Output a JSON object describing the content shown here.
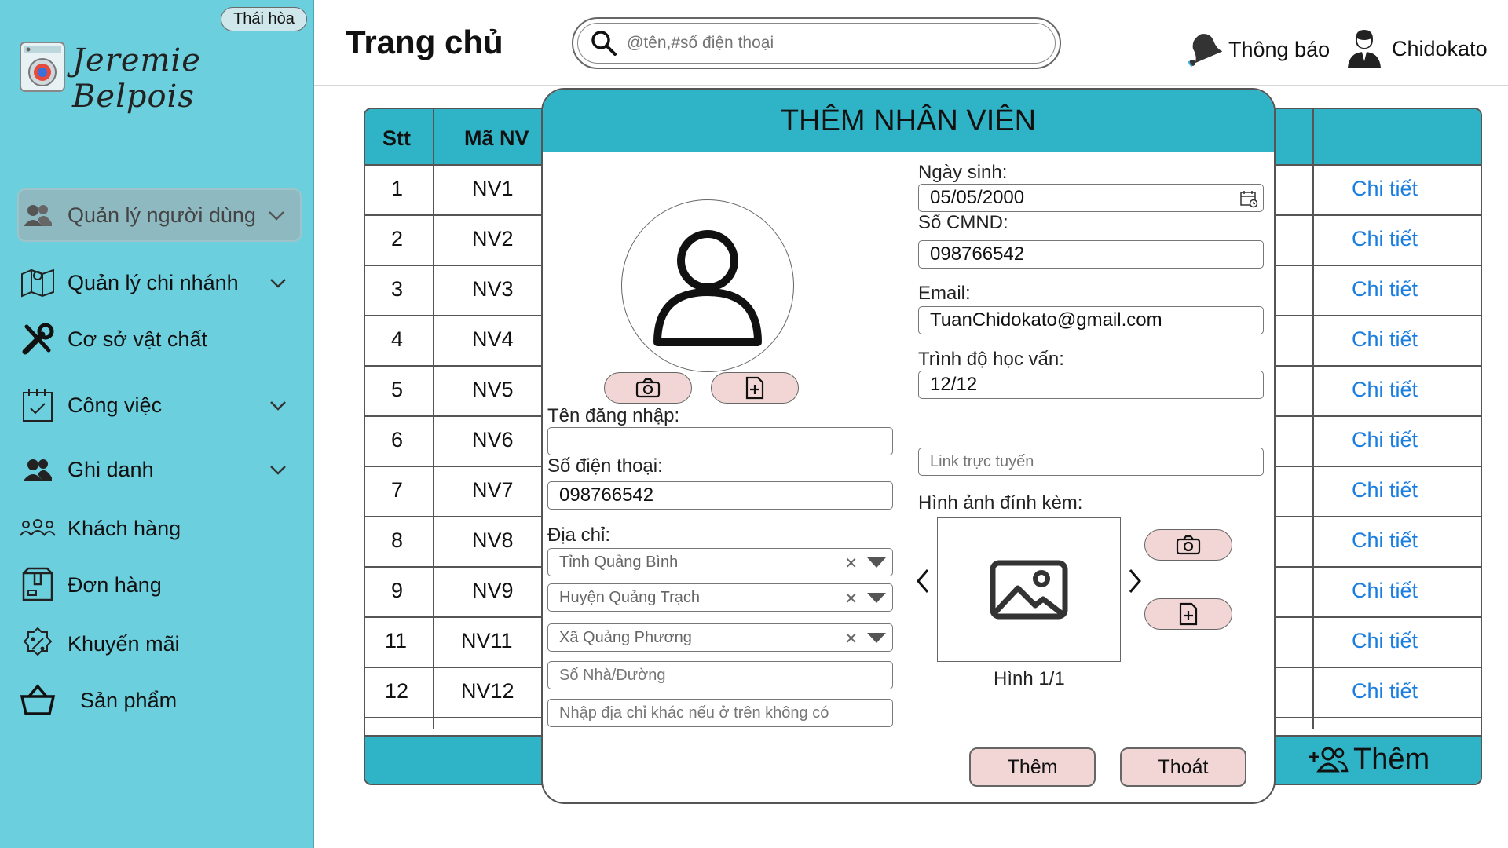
{
  "sidebar": {
    "branch_badge": "Thái hòa",
    "brand": "Jeremie Belpois",
    "items": [
      {
        "label": "Quản lý người dùng",
        "icon": "users-icon",
        "expandable": true,
        "active": true
      },
      {
        "label": "Quản lý chi nhánh",
        "icon": "map-icon",
        "expandable": true
      },
      {
        "label": "Cơ sở vật chất",
        "icon": "tools-icon",
        "expandable": false
      },
      {
        "label": "Công việc",
        "icon": "task-calendar-icon",
        "expandable": true
      },
      {
        "label": "Ghi danh",
        "icon": "enroll-icon",
        "expandable": true
      },
      {
        "label": "Khách hàng",
        "icon": "customers-icon",
        "expandable": false
      },
      {
        "label": "Đơn hàng",
        "icon": "order-box-icon",
        "expandable": false
      },
      {
        "label": "Khuyến mãi",
        "icon": "discount-icon",
        "expandable": false
      },
      {
        "label": "Sản phẩm",
        "icon": "basket-icon",
        "expandable": false
      }
    ]
  },
  "header": {
    "title": "Trang chủ",
    "search_placeholder": "@tên,#số điện thoại",
    "notifications_label": "Thông báo",
    "user_name": "Chidokato"
  },
  "table": {
    "columns": [
      "Stt",
      "Mã NV"
    ],
    "rows": [
      {
        "stt": "1",
        "code": "NV1",
        "action": "Chi tiết"
      },
      {
        "stt": "2",
        "code": "NV2",
        "action": "Chi tiết"
      },
      {
        "stt": "3",
        "code": "NV3",
        "action": "Chi tiết"
      },
      {
        "stt": "4",
        "code": "NV4",
        "action": "Chi tiết"
      },
      {
        "stt": "5",
        "code": "NV5",
        "action": "Chi tiết"
      },
      {
        "stt": "6",
        "code": "NV6",
        "action": "Chi tiết"
      },
      {
        "stt": "7",
        "code": "NV7",
        "action": "Chi tiết"
      },
      {
        "stt": "8",
        "code": "NV8",
        "action": "Chi tiết"
      },
      {
        "stt": "9",
        "code": "NV9",
        "action": "Chi tiết"
      },
      {
        "stt": "11",
        "code": "NV11",
        "action": "Chi tiết"
      },
      {
        "stt": "12",
        "code": "NV12",
        "action": "Chi tiết"
      }
    ],
    "add_label": "Thêm"
  },
  "modal": {
    "title": "THÊM NHÂN VIÊN",
    "username_label": "Tên đăng nhập:",
    "username_value": "",
    "phone_label": "Số điện thoại:",
    "phone_value": "098766542",
    "address_label": "Địa chỉ:",
    "province_value": "Tỉnh Quảng Bình",
    "district_value": "Huyện Quảng Trạch",
    "ward_value": "Xã Quảng Phương",
    "street_placeholder": "Số Nhà/Đường",
    "other_address_placeholder": "Nhập địa chỉ khác nếu ở trên không có",
    "dob_label": "Ngày sinh:",
    "dob_value": "05/05/2000",
    "id_label": "Số CMND:",
    "id_value": "098766542",
    "email_label": "Email:",
    "email_value": "TuanChidokato@gmail.com",
    "education_label": "Trình độ học vấn:",
    "education_value": "12/12",
    "online_link_placeholder": "Link trực tuyến",
    "attachments_label": "Hình ảnh đính kèm:",
    "image_counter": "Hình 1/1",
    "submit_label": "Thêm",
    "exit_label": "Thoát"
  },
  "colors": {
    "sidebar_bg": "#6ccfdd",
    "header_teal": "#2eb4c6",
    "link_blue": "#1a7de0",
    "button_pink": "#f2d6d6"
  }
}
